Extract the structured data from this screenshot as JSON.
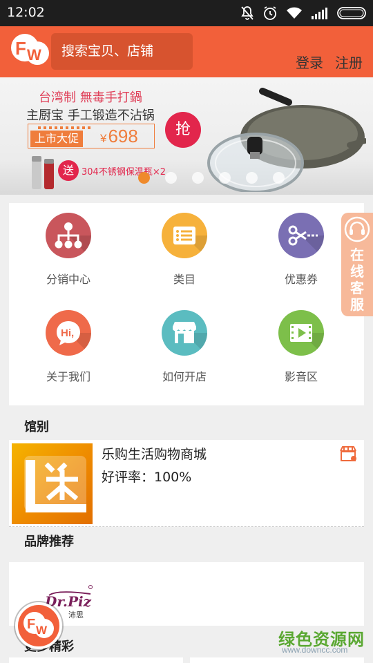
{
  "status_bar": {
    "time": "12:02"
  },
  "header": {
    "search_placeholder": "搜索宝贝、店铺",
    "login": "登录",
    "register": "注册"
  },
  "banner": {
    "line1": "台湾制 無毒手打鍋",
    "line2": "主厨宝 手工锻造不沾锅",
    "promo_tag": "上市大促",
    "price_symbol": "¥",
    "price": "698",
    "grab": "抢",
    "send": "送",
    "gift": "304不锈钢保温瓶×2",
    "slide_count": 6,
    "active_slide": 1
  },
  "grid": [
    {
      "label": "分销中心",
      "icon": "network-icon",
      "color": "#c9565c"
    },
    {
      "label": "类目",
      "icon": "list-icon",
      "color": "#f6b13b"
    },
    {
      "label": "优惠券",
      "icon": "scissors-icon",
      "color": "#7a6fb3"
    },
    {
      "label": "关于我们",
      "icon": "chat-bubble-icon",
      "color": "#ef6a4a"
    },
    {
      "label": "如何开店",
      "icon": "storefront-icon",
      "color": "#5bbcc0"
    },
    {
      "label": "影音区",
      "icon": "video-icon",
      "color": "#7dbf4a"
    }
  ],
  "service": {
    "label": "在线客服"
  },
  "sections": {
    "shop_type": "馆别",
    "brand": "品牌推荐",
    "more": "更多精彩"
  },
  "shop": {
    "name": "乐购生活购物商城",
    "rating": "好评率：100%"
  },
  "brand": {
    "name": "沛思",
    "logo_text": "Dr.Piz"
  },
  "watermark": {
    "brand": "绿色资源网",
    "url": "www.downcc.com"
  },
  "colors": {
    "header": "#f2603a",
    "accent": "#ef8a2c"
  }
}
